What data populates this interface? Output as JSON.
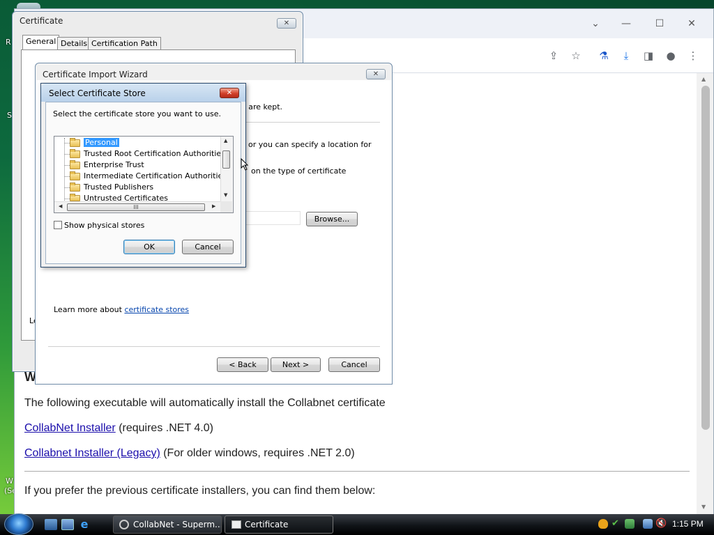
{
  "desktop": {
    "fragments": [
      "R",
      "S",
      "W",
      "(Se"
    ]
  },
  "browser": {
    "window_controls": {
      "dropdown": "⌄",
      "minimize": "—",
      "maximize": "☐",
      "close": "✕"
    },
    "toolbar_icons": [
      "share-icon",
      "star-icon",
      "labs-icon",
      "download-icon",
      "sidebar-icon",
      "profile-icon",
      "menu-icon"
    ],
    "page": {
      "heading_fragment": "W",
      "intro": "The following executable will automatically install the Collabnet certificate",
      "link1": "CollabNet Installer",
      "link1_suffix": "(requires .NET 4.0)",
      "link2": "Collabnet Installer (Legacy)",
      "link2_suffix": "(For older windows, requires .NET 2.0)",
      "prev_text": "If you prefer the previous certificate installers, you can find them below:"
    }
  },
  "certificate_window": {
    "title": "Certificate",
    "tabs": [
      "General",
      "Details",
      "Certification Path"
    ],
    "selected_tab": "General",
    "fragment": "Le"
  },
  "wizard": {
    "title": "Certificate Import Wizard",
    "text1": "s are kept.",
    "text2": "or you can specify a location for",
    "text3": "on the type of certificate",
    "browse": "Browse...",
    "learn_more_prefix": "Learn more about ",
    "learn_more_link": "certificate stores",
    "back": "< Back",
    "next": "Next >",
    "cancel": "Cancel"
  },
  "select_store": {
    "title": "Select Certificate Store",
    "prompt": "Select the certificate store you want to use.",
    "stores": [
      "Personal",
      "Trusted Root Certification Authorities",
      "Enterprise Trust",
      "Intermediate Certification Authorities",
      "Trusted Publishers",
      "Untrusted Certificates"
    ],
    "selected": "Personal",
    "hscroll_grip": "III",
    "show_physical": "Show physical stores",
    "show_physical_checked": false,
    "ok": "OK",
    "cancel": "Cancel"
  },
  "taskbar": {
    "tasks": [
      {
        "label": "CollabNet - Superm...",
        "active": false
      },
      {
        "label": "Certificate",
        "active": true
      }
    ],
    "clock": "1:15 PM"
  }
}
